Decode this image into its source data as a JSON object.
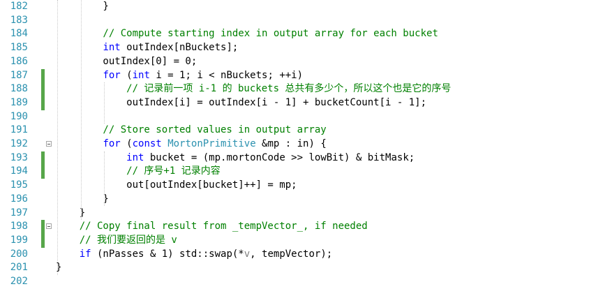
{
  "editor": {
    "lines": [
      {
        "num": "182",
        "changed": false,
        "fold": false,
        "tokens": [
          {
            "t": "        }",
            "c": "pl"
          }
        ]
      },
      {
        "num": "183",
        "changed": false,
        "fold": false,
        "tokens": []
      },
      {
        "num": "184",
        "changed": false,
        "fold": false,
        "tokens": [
          {
            "t": "        // Compute starting index in output array for each bucket",
            "c": "cm"
          }
        ]
      },
      {
        "num": "185",
        "changed": false,
        "fold": false,
        "tokens": [
          {
            "t": "        ",
            "c": "pl"
          },
          {
            "t": "int",
            "c": "kw"
          },
          {
            "t": " outIndex[nBuckets];",
            "c": "pl"
          }
        ]
      },
      {
        "num": "186",
        "changed": false,
        "fold": false,
        "tokens": [
          {
            "t": "        outIndex[0] = 0;",
            "c": "pl"
          }
        ]
      },
      {
        "num": "187",
        "changed": true,
        "fold": false,
        "tokens": [
          {
            "t": "        ",
            "c": "pl"
          },
          {
            "t": "for",
            "c": "kw"
          },
          {
            "t": " (",
            "c": "pl"
          },
          {
            "t": "int",
            "c": "kw"
          },
          {
            "t": " i = 1; i < nBuckets; ++i)",
            "c": "pl"
          }
        ]
      },
      {
        "num": "188",
        "changed": true,
        "fold": false,
        "tokens": [
          {
            "t": "            // 记录前一项 i-1 的 buckets 总共有多少个，所以这个也是它的序号",
            "c": "cm"
          }
        ]
      },
      {
        "num": "189",
        "changed": true,
        "fold": false,
        "tokens": [
          {
            "t": "            outIndex[i] = outIndex[i - 1] + bucketCount[i - 1];",
            "c": "pl"
          }
        ]
      },
      {
        "num": "190",
        "changed": false,
        "fold": false,
        "tokens": []
      },
      {
        "num": "191",
        "changed": false,
        "fold": false,
        "tokens": [
          {
            "t": "        // Store sorted values in output array",
            "c": "cm"
          }
        ]
      },
      {
        "num": "192",
        "changed": false,
        "fold": true,
        "tokens": [
          {
            "t": "        ",
            "c": "pl"
          },
          {
            "t": "for",
            "c": "kw"
          },
          {
            "t": " (",
            "c": "pl"
          },
          {
            "t": "const",
            "c": "kw"
          },
          {
            "t": " ",
            "c": "pl"
          },
          {
            "t": "MortonPrimitive",
            "c": "ty"
          },
          {
            "t": " &mp : in) {",
            "c": "pl"
          }
        ]
      },
      {
        "num": "193",
        "changed": true,
        "fold": false,
        "tokens": [
          {
            "t": "            ",
            "c": "pl"
          },
          {
            "t": "int",
            "c": "kw"
          },
          {
            "t": " bucket = (mp.mortonCode >> lowBit) & bitMask;",
            "c": "pl"
          }
        ]
      },
      {
        "num": "194",
        "changed": true,
        "fold": false,
        "tokens": [
          {
            "t": "            // 序号+1 记录内容",
            "c": "cm"
          }
        ]
      },
      {
        "num": "195",
        "changed": false,
        "fold": false,
        "tokens": [
          {
            "t": "            out[outIndex[bucket]++] = mp;",
            "c": "pl"
          }
        ]
      },
      {
        "num": "196",
        "changed": false,
        "fold": false,
        "tokens": [
          {
            "t": "        }",
            "c": "pl"
          }
        ]
      },
      {
        "num": "197",
        "changed": false,
        "fold": false,
        "tokens": [
          {
            "t": "    }",
            "c": "pl"
          }
        ]
      },
      {
        "num": "198",
        "changed": true,
        "fold": true,
        "tokens": [
          {
            "t": "    // Copy final result from _tempVector_, if needed",
            "c": "cm"
          }
        ]
      },
      {
        "num": "199",
        "changed": true,
        "fold": false,
        "tokens": [
          {
            "t": "    // 我们要返回的是 v",
            "c": "cm"
          }
        ]
      },
      {
        "num": "200",
        "changed": false,
        "fold": false,
        "tokens": [
          {
            "t": "    ",
            "c": "pl"
          },
          {
            "t": "if",
            "c": "kw"
          },
          {
            "t": " (nPasses & 1) std::swap(*",
            "c": "pl"
          },
          {
            "t": "v",
            "c": "gr"
          },
          {
            "t": ", tempVector);",
            "c": "pl"
          }
        ]
      },
      {
        "num": "201",
        "changed": false,
        "fold": false,
        "tokens": [
          {
            "t": "}",
            "c": "pl"
          }
        ]
      },
      {
        "num": "202",
        "changed": false,
        "fold": false,
        "tokens": []
      }
    ]
  }
}
